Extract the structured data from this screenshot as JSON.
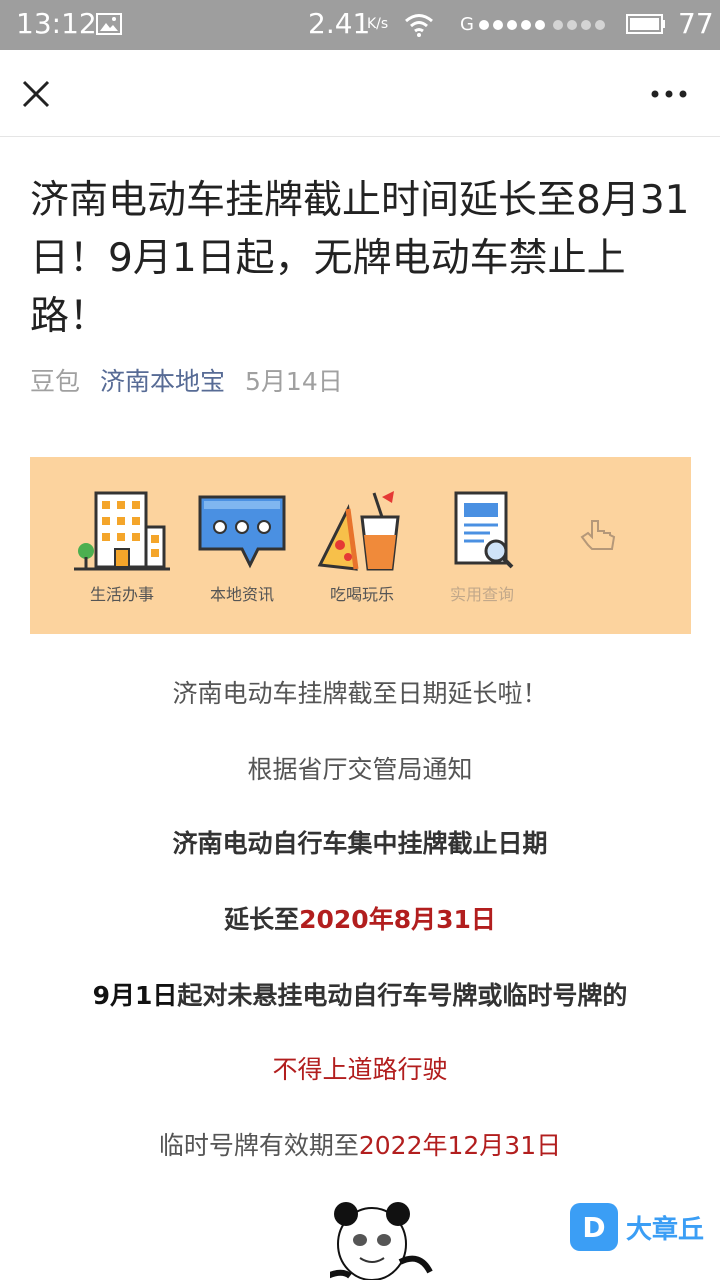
{
  "status_bar": {
    "time": "13:12",
    "network_speed": "2.41",
    "speed_unit": "K/s",
    "network_type": "G",
    "battery": "77",
    "icons": [
      "image-icon",
      "wifi-icon",
      "signal-icon",
      "battery-icon"
    ]
  },
  "navbar": {
    "close_icon": "close-icon",
    "more_icon": "more-icon"
  },
  "article": {
    "title": "济南电动车挂牌截止时间延长至8月31日！9月1日起，无牌电动车禁止上路！",
    "author": "豆包",
    "account": "济南本地宝",
    "date": "5月14日"
  },
  "banner": {
    "background": "#fcd39e",
    "items": [
      {
        "label": "生活办事",
        "icon": "building-icon"
      },
      {
        "label": "本地资讯",
        "icon": "chat-bubble-icon"
      },
      {
        "label": "吃喝玩乐",
        "icon": "food-drink-icon"
      },
      {
        "label": "实用查询",
        "icon": "document-search-icon"
      }
    ]
  },
  "body": {
    "p1": "济南电动车挂牌截至日期延长啦！",
    "p2": "根据省厅交管局通知",
    "p3": "济南电动自行车集中挂牌截止日期",
    "p4_prefix": "延长至",
    "p4_date": "2020年8月31日",
    "p5_prefix": "9月1日",
    "p5_rest": "起对未悬挂电动自行车号牌或临时号牌的",
    "p6": "不得上道路行驶",
    "p7_prefix": "临时号牌有效期至",
    "p7_date": "2022年12月31日"
  },
  "watermark": {
    "logo_letter": "D",
    "text": "大章丘"
  },
  "colors": {
    "accent_link": "#576b95",
    "red_text": "#b21e1e",
    "status_bar": "#9e9e9e"
  }
}
